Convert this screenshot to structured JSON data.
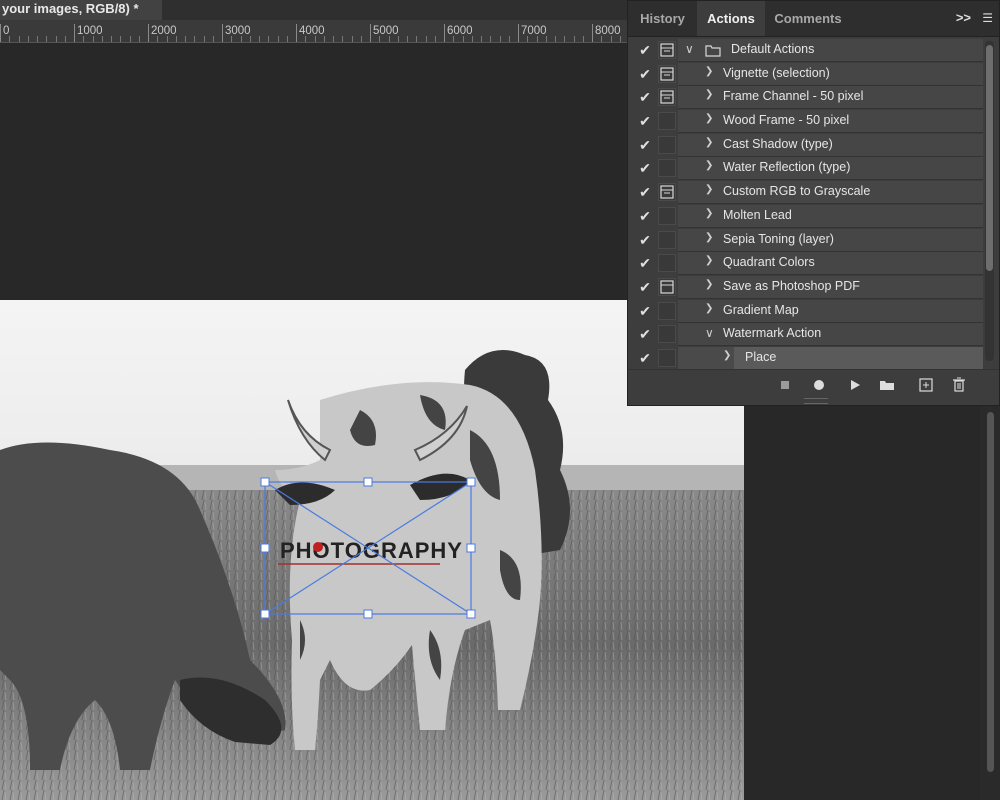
{
  "document": {
    "tab_title": "your images, RGB/8) *"
  },
  "ruler": {
    "labels": [
      "0",
      "1000",
      "2000",
      "3000",
      "4000",
      "5000",
      "6000",
      "7000",
      "8000"
    ]
  },
  "panel": {
    "tabs": [
      {
        "label": "History",
        "active": false
      },
      {
        "label": "Actions",
        "active": true
      },
      {
        "label": "Comments",
        "active": false
      }
    ],
    "collapse_label": ">>",
    "actions": [
      {
        "name": "Default Actions",
        "checked": true,
        "dialog": true,
        "folder": true,
        "expanded": true
      },
      {
        "name": "Vignette (selection)",
        "checked": true,
        "dialog": true
      },
      {
        "name": "Frame Channel - 50 pixel",
        "checked": true,
        "dialog": true
      },
      {
        "name": "Wood Frame - 50 pixel",
        "checked": true,
        "dialog": false
      },
      {
        "name": "Cast Shadow (type)",
        "checked": true,
        "dialog": false
      },
      {
        "name": "Water Reflection (type)",
        "checked": true,
        "dialog": false
      },
      {
        "name": "Custom RGB to Grayscale",
        "checked": true,
        "dialog": true
      },
      {
        "name": "Molten Lead",
        "checked": true,
        "dialog": false
      },
      {
        "name": "Sepia Toning (layer)",
        "checked": true,
        "dialog": false
      },
      {
        "name": "Quadrant Colors",
        "checked": true,
        "dialog": false
      },
      {
        "name": "Save as Photoshop PDF",
        "checked": true,
        "dialog": true
      },
      {
        "name": "Gradient Map",
        "checked": true,
        "dialog": false
      },
      {
        "name": "Watermark Action",
        "checked": true,
        "dialog": false,
        "expanded": true
      },
      {
        "name": "Place",
        "checked": true,
        "dialog": false,
        "step": true,
        "selected": true
      }
    ],
    "toolbar_icons": [
      "stop-icon",
      "record-icon",
      "play-icon",
      "new-set-icon",
      "new-action-icon",
      "delete-icon"
    ]
  },
  "canvas": {
    "watermark_text": "PHOTOGRAPHY"
  }
}
